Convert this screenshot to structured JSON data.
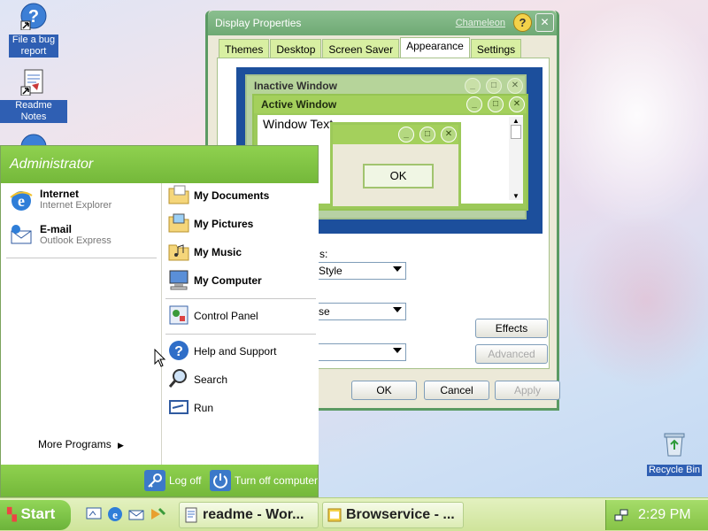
{
  "desktop": {
    "icons": [
      {
        "label": "File a bug report"
      },
      {
        "label": "Readme Notes"
      },
      {
        "label": "Recycle Bin"
      }
    ]
  },
  "display_properties": {
    "title": "Display Properties",
    "chooser_link": "Chameleon",
    "help": "?",
    "tabs": [
      {
        "label": "Themes"
      },
      {
        "label": "Desktop"
      },
      {
        "label": "Screen Saver"
      },
      {
        "label": "Appearance",
        "active": true
      },
      {
        "label": "Settings"
      }
    ],
    "preview": {
      "inactive_title": "Inactive Window",
      "active_title": "Active Window",
      "window_text": "Window Text",
      "msgbox_ok": "OK"
    },
    "fields": [
      {
        "label": "s:",
        "value": "Style"
      },
      {
        "label": "",
        "value": "se"
      },
      {
        "label": "",
        "value": ""
      }
    ],
    "buttons": {
      "effects": "Effects",
      "advanced": "Advanced",
      "ok": "OK",
      "cancel": "Cancel",
      "apply": "Apply"
    }
  },
  "start_menu": {
    "user": "Administrator",
    "pinned": [
      {
        "title": "Internet",
        "subtitle": "Internet Explorer"
      },
      {
        "title": "E-mail",
        "subtitle": "Outlook Express"
      }
    ],
    "more_programs": "More Programs",
    "right_items": [
      {
        "label": "My Documents"
      },
      {
        "label": "My Pictures"
      },
      {
        "label": "My Music"
      },
      {
        "label": "My Computer"
      },
      {
        "label": "Control Panel"
      },
      {
        "label": "Help and Support"
      },
      {
        "label": "Search"
      },
      {
        "label": "Run"
      }
    ],
    "log_off": "Log off",
    "turn_off": "Turn off computer"
  },
  "taskbar": {
    "start": "Start",
    "tasks": [
      {
        "label": "readme - Wor..."
      },
      {
        "label": "Browservice - ..."
      }
    ],
    "clock": "2:29 PM"
  },
  "colors": {
    "accent_green": "#8fd14f",
    "window_frame": "#5b9a63",
    "preview_blue": "#1c4f9c"
  }
}
